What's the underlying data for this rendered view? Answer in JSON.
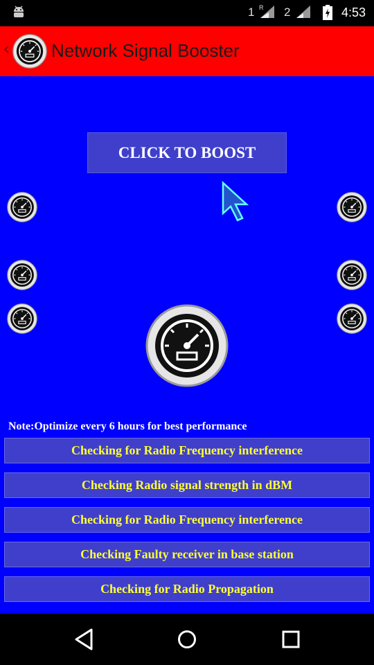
{
  "status_bar": {
    "sim1_label": "1",
    "sim2_label": "2",
    "time": "4:53"
  },
  "app_bar": {
    "title": "Network Signal Booster"
  },
  "boost_button": {
    "label": "CLICK TO BOOST"
  },
  "note": "Note:Optimize every 6 hours for best performance",
  "checks": [
    "Checking for Radio Frequency interference",
    "Checking Radio signal strength in dBM",
    "Checking for Radio Frequency interference",
    "Checking Faulty receiver in base station",
    "Checking for Radio Propagation"
  ],
  "icons": {
    "status_left": "android-icon",
    "signal": "signal-strength-icon",
    "battery": "battery-charging-icon",
    "gauge": "speedometer-icon",
    "back": "back-arrow-icon",
    "cursor": "mouse-cursor-icon",
    "nav_back": "nav-back-icon",
    "nav_home": "nav-home-icon",
    "nav_recents": "nav-recents-icon"
  },
  "colors": {
    "app_bar": "#ff0000",
    "background": "#0000ff",
    "button": "#3f3fcc",
    "check_text": "#ffff33"
  }
}
